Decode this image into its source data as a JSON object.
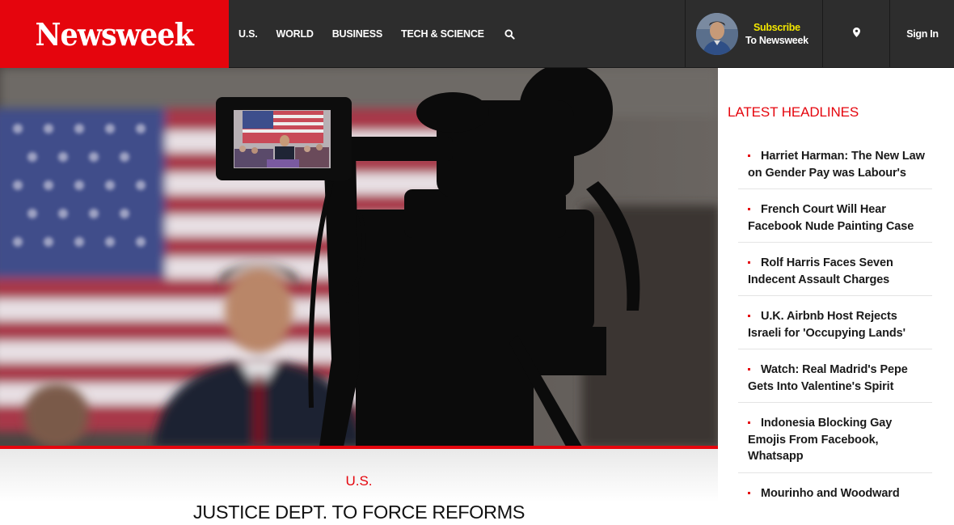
{
  "header": {
    "logo": "Newsweek",
    "nav": [
      "U.S.",
      "WORLD",
      "BUSINESS",
      "TECH & SCIENCE"
    ],
    "subscribe_line1": "Subscribe",
    "subscribe_line2": "To Newsweek",
    "signin": "Sign In",
    "icons": {
      "search": "search-icon",
      "location": "location-pin-icon"
    }
  },
  "hero": {
    "section": "U.S.",
    "title": "JUSTICE DEPT. TO FORCE REFORMS"
  },
  "sidebar": {
    "title": "LATEST HEADLINES",
    "headlines": [
      "Harriet Harman: The New Law on Gender Pay was Labour's",
      "French Court Will Hear Facebook Nude Painting Case",
      "Rolf Harris Faces Seven Indecent Assault Charges",
      "U.K. Airbnb Host Rejects Israeli for 'Occupying Lands'",
      "Watch: Real Madrid's Pepe Gets Into Valentine's Spirit",
      "Indonesia Blocking Gay Emojis From Facebook, Whatsapp",
      "Mourinho and Woodward"
    ]
  },
  "colors": {
    "brand_red": "#e5050d",
    "header_bg": "#2d2d2d",
    "subscribe_yellow": "#f2e600"
  }
}
